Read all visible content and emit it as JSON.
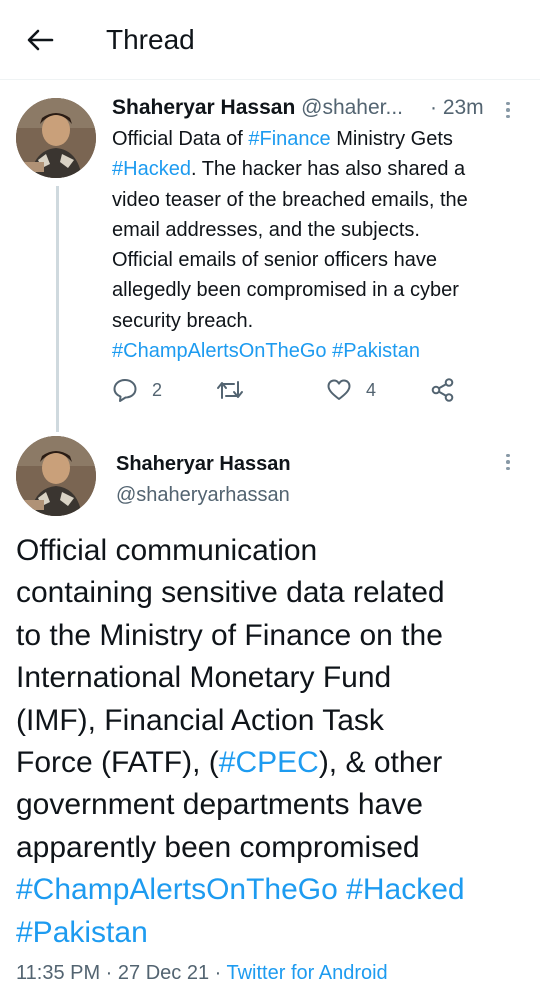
{
  "header": {
    "title": "Thread",
    "back_icon": "arrow-left-icon"
  },
  "tweet1": {
    "author_name": "Shaheryar Hassan",
    "author_handle": "@shaher...",
    "time": "· 23m",
    "lines": [
      [
        {
          "t": "Official Data of "
        },
        {
          "t": "#Finance",
          "tag": true
        },
        {
          "t": " Ministry Gets"
        }
      ],
      [
        {
          "t": "#Hacked",
          "tag": true
        },
        {
          "t": ". The hacker has also shared a"
        }
      ],
      [
        {
          "t": "video teaser of the breached emails, the"
        }
      ],
      [
        {
          "t": "email addresses, and the subjects."
        }
      ],
      [
        {
          "t": "Official emails of senior officers have"
        }
      ],
      [
        {
          "t": "allegedly been compromised in a cyber"
        }
      ],
      [
        {
          "t": "security breach."
        }
      ],
      [
        {
          "t": "#ChampAlertsOnTheGo",
          "tag": true
        },
        {
          "t": " "
        },
        {
          "t": "#Pakistan",
          "tag": true
        }
      ]
    ],
    "reply_count": "2",
    "retweet_count": "",
    "like_count": "4"
  },
  "tweet2": {
    "author_name": "Shaheryar Hassan",
    "author_handle": "@shaheryarhassan",
    "lines": [
      [
        {
          "t": "Official communication"
        }
      ],
      [
        {
          "t": "containing sensitive data related"
        }
      ],
      [
        {
          "t": "to the Ministry of Finance on the"
        }
      ],
      [
        {
          "t": "International Monetary Fund"
        }
      ],
      [
        {
          "t": "(IMF), Financial Action Task"
        }
      ],
      [
        {
          "t": "Force (FATF), ("
        },
        {
          "t": "#CPEC",
          "tag": true
        },
        {
          "t": "), & other"
        }
      ],
      [
        {
          "t": "government departments have"
        }
      ],
      [
        {
          "t": "apparently been compromised"
        }
      ],
      [
        {
          "t": "#ChampAlertsOnTheGo",
          "tag": true
        },
        {
          "t": " "
        },
        {
          "t": "#Hacked",
          "tag": true
        }
      ],
      [
        {
          "t": "#Pakistan",
          "tag": true
        }
      ]
    ],
    "time": "11:35 PM · 27 Dec 21 · ",
    "source": "Twitter for Android"
  },
  "colors": {
    "link": "#1d9bf0",
    "secondary_text": "#536471",
    "thread_line": "#cfd9de"
  }
}
